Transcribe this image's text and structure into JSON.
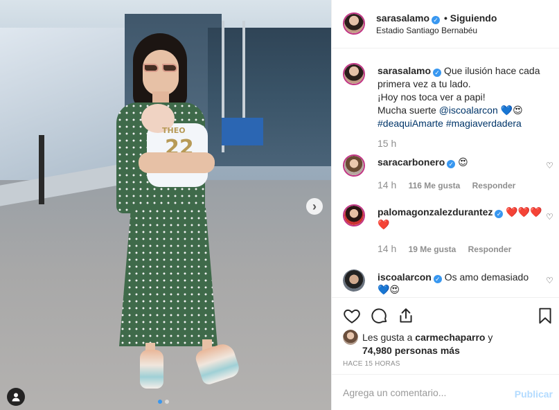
{
  "post": {
    "author": "sarasalamo",
    "follow_status": "• Siguiendo",
    "location": "Estadio Santiago Bernabéu",
    "jersey_name": "THEO",
    "jersey_number": "22"
  },
  "caption": {
    "username": "sarasalamo",
    "line1": "Que ilusión hace cada primera vez a tu lado.",
    "line2": "¡Hoy nos toca ver a papi!",
    "line3_prefix": "Mucha suerte ",
    "mention": "@iscoalarcon",
    "line3_suffix": " 💙😍",
    "hashtag1": "#deaquiAmarte",
    "hashtag2": "#magiaverdadera",
    "time": "15 h"
  },
  "comments": [
    {
      "username": "saracarbonero",
      "text": "😍",
      "time": "14 h",
      "likes": "116 Me gusta",
      "reply": "Responder"
    },
    {
      "username": "palomagonzalezdurantez",
      "text": "❤️❤️❤️❤️",
      "time": "14 h",
      "likes": "19 Me gusta",
      "reply": "Responder"
    },
    {
      "username": "iscoalarcon",
      "text": "Os amo demasiado 💙😍"
    }
  ],
  "likes": {
    "prefix": "Les gusta a ",
    "user": "carmechaparro",
    "mid": " y",
    "count": "74,980 personas más"
  },
  "time_ago": "Hace 15 horas",
  "composer": {
    "placeholder": "Agrega un comentario...",
    "publish_label": "Publicar"
  },
  "colors": {
    "verified": "#3897f0",
    "muted": "#8e8e8e",
    "link": "#003569",
    "publish_disabled": "#b3dbff"
  },
  "icons": [
    "verified-icon",
    "heart-icon",
    "comment-icon",
    "share-icon",
    "bookmark-icon",
    "next-arrow-icon",
    "user-tag-icon"
  ]
}
